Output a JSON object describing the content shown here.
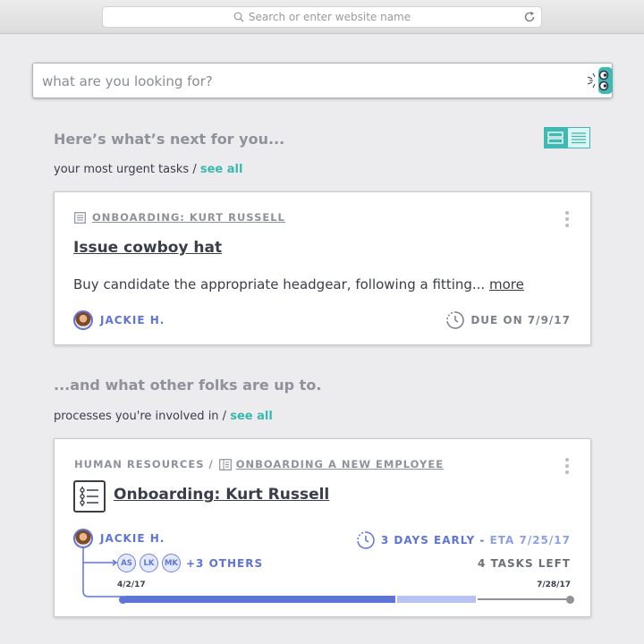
{
  "browser": {
    "url_placeholder": "Search or enter website name"
  },
  "search": {
    "placeholder": "what are you looking for?"
  },
  "next": {
    "heading": "Here’s what’s next for you...",
    "subheading": "your most urgent tasks /",
    "see_all": "see all"
  },
  "task_card": {
    "breadcrumb": "ONBOARDING: KURT RUSSELL",
    "title": "Issue cowboy hat",
    "description": "Buy candidate the appropriate headgear, following a fitting...",
    "more": "more",
    "assignee": "JACKIE H.",
    "due": "DUE ON 7/9/17"
  },
  "others": {
    "heading": "...and what other folks are up to.",
    "subheading": "processes you're involved in /",
    "see_all": "see all"
  },
  "process_card": {
    "department": "HUMAN RESOURCES /",
    "template": "ONBOARDING A NEW EMPLOYEE",
    "title": "Onboarding: Kurt Russell",
    "owner": "JACKIE H.",
    "status": "3 DAYS EARLY -",
    "eta": "ETA 7/25/17",
    "participants": [
      "AS",
      "LK",
      "MK"
    ],
    "others_count": "+3 OTHERS",
    "tasks_left": "4 TASKS LEFT",
    "start_date": "4/2/17",
    "end_date": "7/28/17",
    "progress_fraction": 0.61,
    "eta_fraction": 0.79
  },
  "colors": {
    "accent": "#39b8b0",
    "primary": "#5e74d6",
    "light_primary": "#b7c3f1",
    "text": "#3a3d4a",
    "muted": "#8f919b"
  },
  "icons": [
    "search-icon",
    "reload-icon",
    "robot-mascot-icon",
    "card-view-icon",
    "list-view-icon",
    "checklist-icon",
    "kebab-menu-icon",
    "clock-icon",
    "avatar"
  ]
}
